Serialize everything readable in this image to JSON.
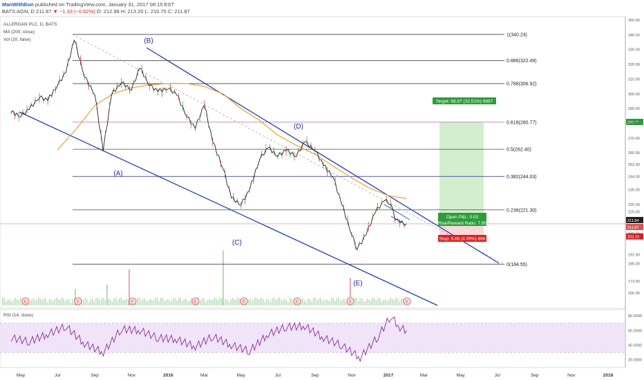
{
  "header": {
    "author": "ManWithBun",
    "published": "published on TradingView.com, January 31, 2017 08:15 EST",
    "symbol": "BATS:AGN, D",
    "price": "211.87",
    "change": "▼ −1.33 (−0.62%)",
    "ohlc": "O: 212.98  H: 213.20  L: 210.75  C: 211.87"
  },
  "legend": {
    "title": "ALLERGAN PLC, D, BATS",
    "ma": "MA (200, close)",
    "vol": "Vol (20, false)",
    "rsi": "RSI (14, close)"
  },
  "colors": {
    "price": "#1f1f1f",
    "ma": "#f0a020",
    "channel": "#1e3cc8",
    "fib": "#222222",
    "fib_618": "#b040c0",
    "fib_382": "#2020a0",
    "rsi": "#8a2c9c",
    "rsi_band": "#e9d8f7",
    "target_zone": "#c9ecc3",
    "target_label": "#2a9d3a",
    "stop_label": "#e01e1e",
    "volume": "#a8d8a8"
  },
  "chart_data": {
    "type": "line",
    "title": "ALLERGAN PLC, D, BATS",
    "x_tick_labels": [
      "May",
      "Jul",
      "Sep",
      "Nov",
      "2016",
      "Mar",
      "May",
      "Jul",
      "Sep",
      "Nov",
      "2017",
      "Mar",
      "May",
      "Jul",
      "Sep",
      "Nov",
      "2018"
    ],
    "y_tick_labels": [
      "350.00",
      "340.00",
      "330.00",
      "320.00",
      "310.00",
      "300.00",
      "290.00",
      "280.00",
      "270.00",
      "260.00",
      "252.00",
      "244.00",
      "235.00",
      "225.00",
      "220.00",
      "205.00",
      "191.00",
      "185.00",
      "173.00",
      "165.00"
    ],
    "ylim": [
      165,
      350
    ],
    "price_series": {
      "name": "AGN",
      "x": [
        "2015-04-15",
        "2015-05-01",
        "2015-05-15",
        "2015-06-01",
        "2015-06-15",
        "2015-07-01",
        "2015-07-15",
        "2015-07-29",
        "2015-08-15",
        "2015-09-01",
        "2015-09-15",
        "2015-09-29",
        "2015-10-15",
        "2015-11-01",
        "2015-11-15",
        "2015-12-01",
        "2015-12-15",
        "2016-01-01",
        "2016-01-15",
        "2016-02-01",
        "2016-02-15",
        "2016-03-01",
        "2016-03-15",
        "2016-04-01",
        "2016-04-15",
        "2016-05-01",
        "2016-05-15",
        "2016-06-01",
        "2016-06-15",
        "2016-07-01",
        "2016-07-15",
        "2016-08-01",
        "2016-08-15",
        "2016-09-01",
        "2016-09-15",
        "2016-10-01",
        "2016-10-15",
        "2016-11-01",
        "2016-11-10",
        "2016-11-25",
        "2016-12-10",
        "2016-12-25",
        "2017-01-05",
        "2017-01-12",
        "2017-01-20",
        "2017-01-31"
      ],
      "y": [
        288,
        285,
        290,
        298,
        296,
        306,
        315,
        337,
        312,
        300,
        262,
        300,
        308,
        303,
        318,
        306,
        302,
        304,
        300,
        285,
        277,
        293,
        268,
        250,
        230,
        225,
        235,
        256,
        264,
        258,
        262,
        258,
        268,
        262,
        252,
        244,
        226,
        205,
        195,
        205,
        220,
        228,
        226,
        215,
        213,
        211.87
      ]
    },
    "ma_series": {
      "name": "MA (200, close)",
      "x": [
        "2015-07-01",
        "2015-08-01",
        "2015-09-01",
        "2015-10-01",
        "2015-11-01",
        "2015-12-01",
        "2016-01-01",
        "2016-02-01",
        "2016-03-01",
        "2016-04-01",
        "2016-05-01",
        "2016-06-01",
        "2016-07-01",
        "2016-08-01",
        "2016-09-01",
        "2016-10-01",
        "2016-11-01",
        "2016-12-01",
        "2017-01-01",
        "2017-01-31"
      ],
      "y": [
        262,
        276,
        292,
        300,
        304,
        306,
        307,
        307,
        305,
        300,
        290,
        282,
        272,
        265,
        259,
        251,
        243,
        236,
        231,
        229
      ]
    },
    "rsi_series": {
      "name": "RSI (14, close)",
      "x": [
        "2015-04-15",
        "2015-05-15",
        "2015-06-15",
        "2015-07-15",
        "2015-08-15",
        "2015-09-15",
        "2015-10-15",
        "2015-11-15",
        "2015-12-15",
        "2016-01-15",
        "2016-02-15",
        "2016-03-15",
        "2016-04-15",
        "2016-05-15",
        "2016-06-15",
        "2016-07-15",
        "2016-08-15",
        "2016-09-15",
        "2016-10-15",
        "2016-11-15",
        "2016-12-15",
        "2017-01-05",
        "2017-01-20",
        "2017-01-31"
      ],
      "y": [
        50,
        45,
        55,
        66,
        42,
        30,
        62,
        60,
        50,
        48,
        38,
        52,
        40,
        32,
        55,
        65,
        66,
        50,
        40,
        23,
        52,
        80,
        64,
        60
      ]
    },
    "rsi_ylim": [
      14,
      84
    ],
    "rsi_tick_labels": [
      "80.0000",
      "60.0000",
      "40.0000",
      "20.0000"
    ],
    "fib_levels": [
      {
        "label": "1(340.24)",
        "value": 340.24
      },
      {
        "label": "0.886(322.49)",
        "value": 322.49
      },
      {
        "label": "0.786(306.92)",
        "value": 306.92
      },
      {
        "label": "0.618(280.77)",
        "value": 280.77
      },
      {
        "label": "0.5(262.40)",
        "value": 262.4
      },
      {
        "label": "0.382(244.03)",
        "value": 244.03
      },
      {
        "label": "0.236(221.30)",
        "value": 221.3
      },
      {
        "label": "0(184.55)",
        "value": 184.55
      }
    ],
    "wave_labels": [
      "(A)",
      "(B)",
      "(C)",
      "(D)",
      "(E)"
    ],
    "position": {
      "target_label": "Target: 68.87 (32.51%) 6887",
      "open_pnl": "Open P&L: 0.03",
      "risk_reward": "Risk/Reward Ratio: 7.95",
      "stop_label": "Stop: 8.66 (4.09%) 866"
    },
    "axis_price_tags": [
      "280.71",
      "211.84",
      "211.87",
      "203.10"
    ],
    "earnings_marker": "E"
  }
}
